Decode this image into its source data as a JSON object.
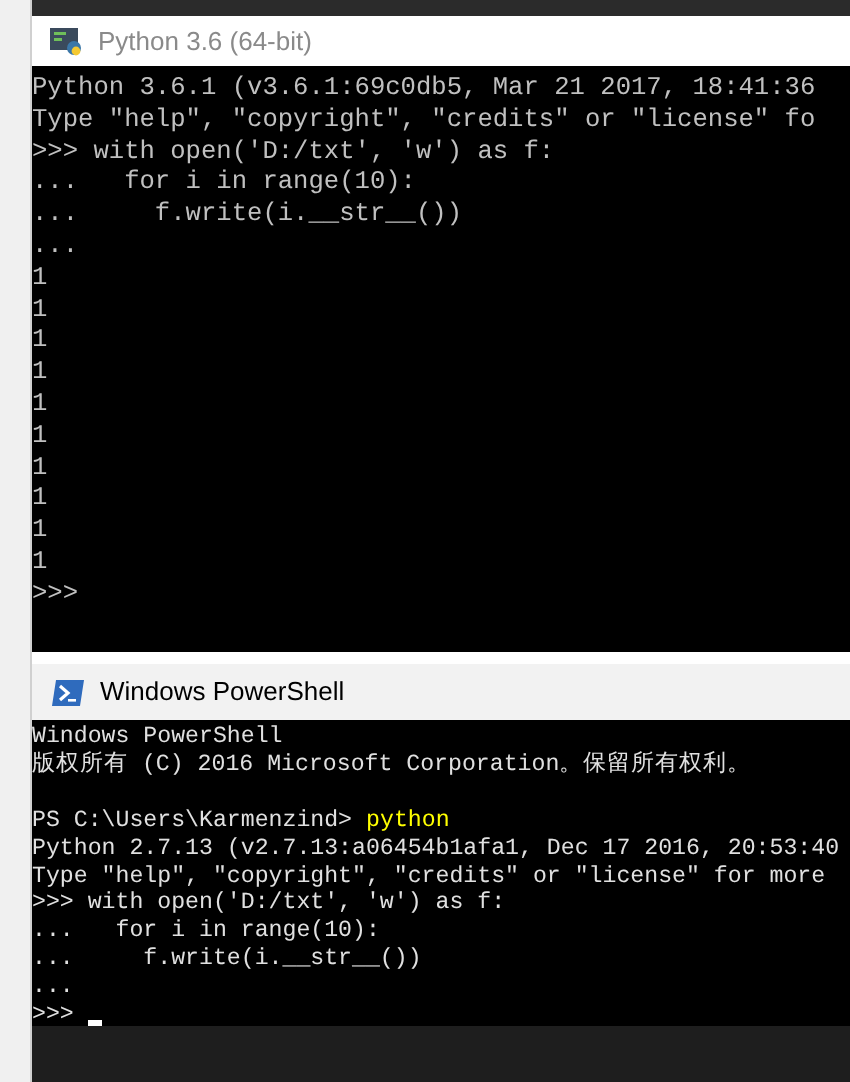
{
  "python_window": {
    "title": "Python 3.6 (64-bit)",
    "active": false,
    "lines": [
      {
        "kind": "text",
        "text": "Python 3.6.1 (v3.6.1:69c0db5, Mar 21 2017, 18:41:36"
      },
      {
        "kind": "text",
        "text": "Type \"help\", \"copyright\", \"credits\" or \"license\" fo"
      },
      {
        "kind": "text",
        "text": ">>> with open('D:/txt', 'w') as f:"
      },
      {
        "kind": "text",
        "text": "...   for i in range(10):"
      },
      {
        "kind": "text",
        "text": "...     f.write(i.__str__())"
      },
      {
        "kind": "text",
        "text": "..."
      },
      {
        "kind": "text",
        "text": "1"
      },
      {
        "kind": "text",
        "text": "1"
      },
      {
        "kind": "text",
        "text": "1"
      },
      {
        "kind": "text",
        "text": "1"
      },
      {
        "kind": "text",
        "text": "1"
      },
      {
        "kind": "text",
        "text": "1"
      },
      {
        "kind": "text",
        "text": "1"
      },
      {
        "kind": "text",
        "text": "1"
      },
      {
        "kind": "text",
        "text": "1"
      },
      {
        "kind": "text",
        "text": "1"
      },
      {
        "kind": "text",
        "text": ">>>"
      }
    ]
  },
  "powershell_window": {
    "title": "Windows PowerShell",
    "active": true,
    "lines": [
      {
        "kind": "text",
        "text": "Windows PowerShell"
      },
      {
        "kind": "text",
        "text": "版权所有 (C) 2016 Microsoft Corporation。保留所有权利。"
      },
      {
        "kind": "blank"
      },
      {
        "kind": "command",
        "prompt": "PS C:\\Users\\Karmenzind>",
        "command": "python"
      },
      {
        "kind": "text",
        "text": "Python 2.7.13 (v2.7.13:a06454b1afa1, Dec 17 2016, 20:53:40"
      },
      {
        "kind": "text",
        "text": "Type \"help\", \"copyright\", \"credits\" or \"license\" for more"
      },
      {
        "kind": "text",
        "text": ">>> with open('D:/txt', 'w') as f:"
      },
      {
        "kind": "text",
        "text": "...   for i in range(10):"
      },
      {
        "kind": "text",
        "text": "...     f.write(i.__str__())"
      },
      {
        "kind": "text",
        "text": "..."
      },
      {
        "kind": "cursor",
        "text": ">>>"
      }
    ]
  }
}
